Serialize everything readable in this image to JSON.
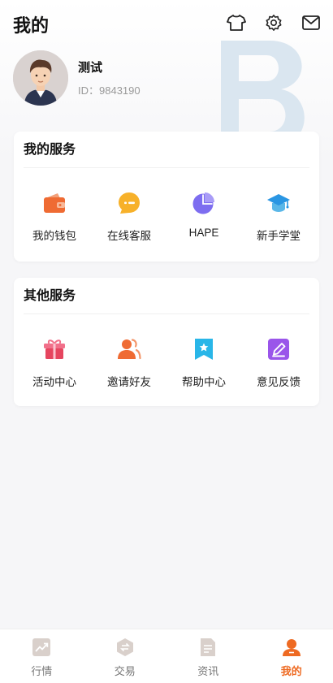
{
  "header": {
    "title": "我的"
  },
  "top_icons": [
    "tshirt-icon",
    "settings-gear-icon",
    "mail-icon"
  ],
  "profile": {
    "name": "测试",
    "id_text": "ID：9843190"
  },
  "my_services": {
    "title": "我的服务",
    "items": [
      {
        "label": "我的钱包",
        "icon": "wallet-icon"
      },
      {
        "label": "在线客服",
        "icon": "chat-bubble-icon"
      },
      {
        "label": "HAPE",
        "icon": "pie-chart-icon"
      },
      {
        "label": "新手学堂",
        "icon": "graduation-cap-icon"
      }
    ]
  },
  "other_services": {
    "title": "其他服务",
    "items": [
      {
        "label": "活动中心",
        "icon": "gift-icon"
      },
      {
        "label": "邀请好友",
        "icon": "invite-people-icon"
      },
      {
        "label": "帮助中心",
        "icon": "bookmark-star-icon"
      },
      {
        "label": "意见反馈",
        "icon": "edit-pen-icon"
      }
    ]
  },
  "tabbar": {
    "items": [
      {
        "label": "行情",
        "icon": "market-chart-icon",
        "active": false
      },
      {
        "label": "交易",
        "icon": "trade-exchange-icon",
        "active": false
      },
      {
        "label": "资讯",
        "icon": "news-document-icon",
        "active": false
      },
      {
        "label": "我的",
        "icon": "profile-person-icon",
        "active": true
      }
    ]
  },
  "colors": {
    "accent": "#ee6a22",
    "inactive_icon": "#d9d0cb",
    "page_bg": "#f6f6f8"
  }
}
